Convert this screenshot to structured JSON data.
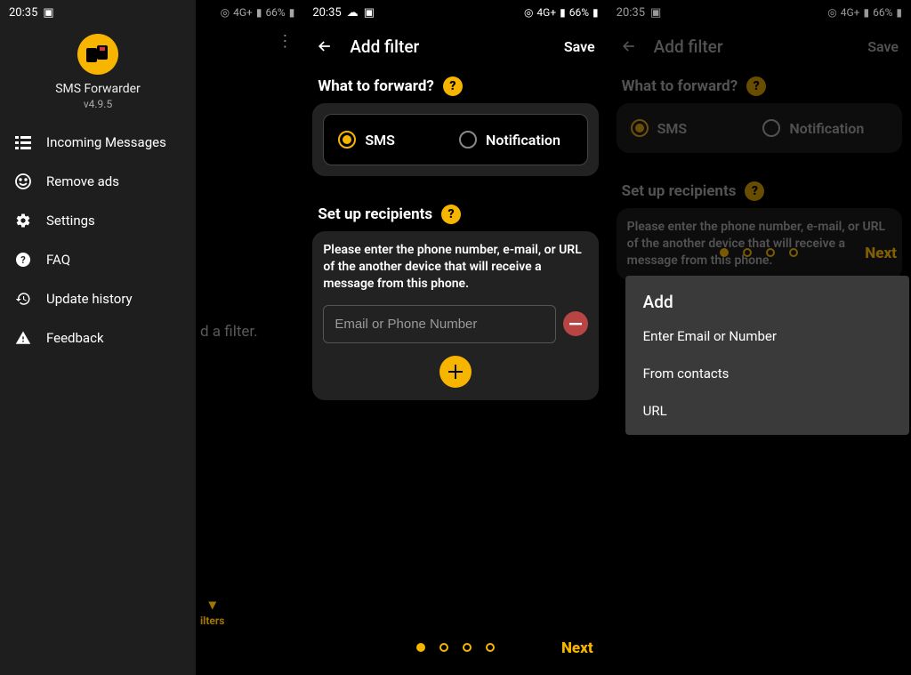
{
  "status": {
    "time": "20:35",
    "battery": "66%",
    "signal": "4G+"
  },
  "drawer": {
    "app_name": "SMS Forwarder",
    "version": "v4.9.5",
    "items": [
      {
        "label": "Incoming Messages",
        "icon": "list-icon"
      },
      {
        "label": "Remove ads",
        "icon": "smile-icon"
      },
      {
        "label": "Settings",
        "icon": "gear-icon"
      },
      {
        "label": "FAQ",
        "icon": "help-icon"
      },
      {
        "label": "Update history",
        "icon": "history-icon"
      },
      {
        "label": "Feedback",
        "icon": "warning-icon"
      }
    ]
  },
  "behind": {
    "hint": "d a filter.",
    "pill": "ilters"
  },
  "add_filter": {
    "title": "Add filter",
    "save": "Save",
    "forward_title": "What to forward?",
    "option_sms": "SMS",
    "option_notification": "Notification",
    "recipients_title": "Set up recipients",
    "recipients_help": "Please enter the phone number, e-mail, or URL of the another device that will receive a message from this phone.",
    "input_placeholder": "Email or Phone Number",
    "next": "Next"
  },
  "sheet": {
    "title": "Add",
    "items": [
      "Enter Email or Number",
      "From contacts",
      "URL"
    ]
  }
}
